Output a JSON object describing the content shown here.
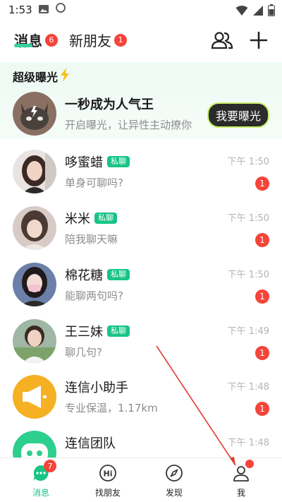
{
  "status_bar": {
    "time": "1:53"
  },
  "header": {
    "tabs": [
      {
        "label": "消息",
        "badge": "6"
      },
      {
        "label": "新朋友",
        "badge": "1"
      }
    ]
  },
  "super_exposure": {
    "title": "超级曝光",
    "item_title": "一秒成为人气王",
    "item_sub": "开启曝光，让异性主动撩你",
    "button": "我要曝光"
  },
  "conversations": [
    {
      "name": "哆蜜蜡",
      "tag": "私聊",
      "message": "单身可聊吗?",
      "time": "下午 1:50",
      "unread": "1"
    },
    {
      "name": "米米",
      "tag": "私聊",
      "message": "陪我聊天嘛",
      "time": "下午 1:50",
      "unread": "1"
    },
    {
      "name": "棉花糖",
      "tag": "私聊",
      "message": "能聊两句吗?",
      "time": "下午 1:50",
      "unread": "1"
    },
    {
      "name": "王三妹",
      "tag": "私聊",
      "message": "聊几句?",
      "time": "下午 1:49",
      "unread": "1"
    },
    {
      "name": "连信小助手",
      "tag": "",
      "message": "专业保温，1.17km",
      "time": "下午 1:48",
      "unread": "1"
    },
    {
      "name": "连信团队",
      "tag": "",
      "message": "",
      "time": "下午 1:48",
      "unread": ""
    }
  ],
  "bottom_nav": [
    {
      "label": "消息",
      "badge": "7",
      "active": true
    },
    {
      "label": "找朋友"
    },
    {
      "label": "发现"
    },
    {
      "label": "我"
    }
  ],
  "colors": {
    "accent": "#18c486",
    "badge": "#f5443a",
    "annotation_arrow": "#e03a32"
  }
}
